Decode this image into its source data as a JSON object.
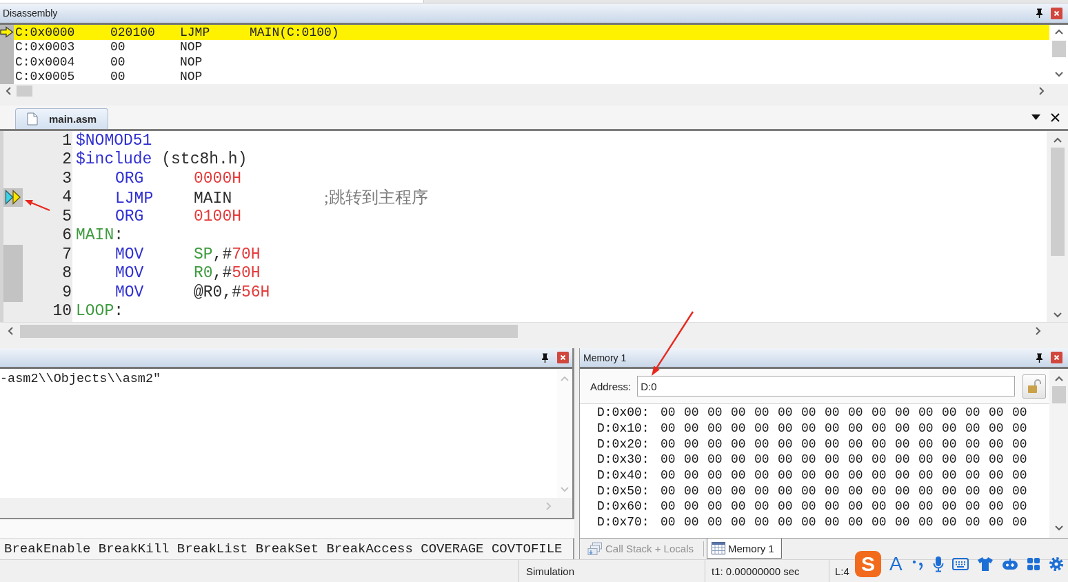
{
  "disassembly": {
    "title": "Disassembly",
    "rows": [
      {
        "address": "C:0x0000",
        "bytes": "020100",
        "mnemonic": "LJMP",
        "operand": "MAIN(C:0100)",
        "current": true
      },
      {
        "address": "C:0x0003",
        "bytes": "00",
        "mnemonic": "NOP",
        "current": false
      },
      {
        "address": "C:0x0004",
        "bytes": "00",
        "mnemonic": "NOP",
        "current": false
      },
      {
        "address": "C:0x0005",
        "bytes": "00",
        "mnemonic": "NOP",
        "current": false
      }
    ]
  },
  "editor": {
    "tabs": [
      {
        "label": "main.asm",
        "selected": true
      }
    ],
    "lines": [
      {
        "number": "1",
        "executable": false,
        "current": false,
        "head": [
          {
            "kind": "directive",
            "text": "$NOMOD51"
          }
        ]
      },
      {
        "number": "2",
        "executable": false,
        "current": false,
        "head": [
          {
            "kind": "directive",
            "text": "$include"
          },
          {
            "kind": "plain",
            "text": " (stc8h.h)"
          }
        ]
      },
      {
        "number": "3",
        "executable": false,
        "current": false,
        "mnemonic": "ORG",
        "operand": [
          {
            "kind": "number",
            "text": "0000H"
          }
        ]
      },
      {
        "number": "4",
        "executable": true,
        "current": true,
        "mnemonic": "LJMP",
        "operand": [
          {
            "kind": "plain",
            "text": "MAIN"
          }
        ],
        "comment": ";跳转到主程序"
      },
      {
        "number": "5",
        "executable": false,
        "current": false,
        "mnemonic": "ORG",
        "operand": [
          {
            "kind": "number",
            "text": "0100H"
          }
        ]
      },
      {
        "number": "6",
        "executable": false,
        "current": false,
        "head": [
          {
            "kind": "label",
            "text": "MAIN"
          },
          {
            "kind": "plain",
            "text": ":"
          }
        ]
      },
      {
        "number": "7",
        "executable": true,
        "current": false,
        "mnemonic": "MOV",
        "operand": [
          {
            "kind": "register",
            "text": "SP"
          },
          {
            "kind": "plain",
            "text": ",#"
          },
          {
            "kind": "number",
            "text": "70H"
          }
        ]
      },
      {
        "number": "8",
        "executable": true,
        "current": false,
        "mnemonic": "MOV",
        "operand": [
          {
            "kind": "register",
            "text": "R0"
          },
          {
            "kind": "plain",
            "text": ",#"
          },
          {
            "kind": "number",
            "text": "50H"
          }
        ]
      },
      {
        "number": "9",
        "executable": true,
        "current": false,
        "mnemonic": "MOV",
        "operand": [
          {
            "kind": "plain",
            "text": "@R0,#"
          },
          {
            "kind": "number",
            "text": "56H"
          }
        ]
      },
      {
        "number": "10",
        "executable": false,
        "current": false,
        "head": [
          {
            "kind": "label",
            "text": "LOOP"
          },
          {
            "kind": "plain",
            "text": ":"
          }
        ]
      }
    ]
  },
  "output": {
    "lines": [
      "-asm2\\\\Objects\\\\asm2\""
    ]
  },
  "command_hints": [
    "BreakEnable",
    "BreakKill",
    "BreakList",
    "BreakSet",
    "BreakAccess",
    "COVERAGE",
    "COVTOFILE"
  ],
  "memory": {
    "title": "Memory 1",
    "address_label": "Address:",
    "address_value": "D:0",
    "rows": [
      {
        "address": "D:0x00:",
        "values": [
          "00",
          "00",
          "00",
          "00",
          "00",
          "00",
          "00",
          "00",
          "00",
          "00",
          "00",
          "00",
          "00",
          "00",
          "00",
          "00"
        ]
      },
      {
        "address": "D:0x10:",
        "values": [
          "00",
          "00",
          "00",
          "00",
          "00",
          "00",
          "00",
          "00",
          "00",
          "00",
          "00",
          "00",
          "00",
          "00",
          "00",
          "00"
        ]
      },
      {
        "address": "D:0x20:",
        "values": [
          "00",
          "00",
          "00",
          "00",
          "00",
          "00",
          "00",
          "00",
          "00",
          "00",
          "00",
          "00",
          "00",
          "00",
          "00",
          "00"
        ]
      },
      {
        "address": "D:0x30:",
        "values": [
          "00",
          "00",
          "00",
          "00",
          "00",
          "00",
          "00",
          "00",
          "00",
          "00",
          "00",
          "00",
          "00",
          "00",
          "00",
          "00"
        ]
      },
      {
        "address": "D:0x40:",
        "values": [
          "00",
          "00",
          "00",
          "00",
          "00",
          "00",
          "00",
          "00",
          "00",
          "00",
          "00",
          "00",
          "00",
          "00",
          "00",
          "00"
        ]
      },
      {
        "address": "D:0x50:",
        "values": [
          "00",
          "00",
          "00",
          "00",
          "00",
          "00",
          "00",
          "00",
          "00",
          "00",
          "00",
          "00",
          "00",
          "00",
          "00",
          "00"
        ]
      },
      {
        "address": "D:0x60:",
        "values": [
          "00",
          "00",
          "00",
          "00",
          "00",
          "00",
          "00",
          "00",
          "00",
          "00",
          "00",
          "00",
          "00",
          "00",
          "00",
          "00"
        ]
      },
      {
        "address": "D:0x70:",
        "values": [
          "00",
          "00",
          "00",
          "00",
          "00",
          "00",
          "00",
          "00",
          "00",
          "00",
          "00",
          "00",
          "00",
          "00",
          "00",
          "00"
        ]
      }
    ],
    "tabs": [
      {
        "kind": "call_stack",
        "label": "Call Stack + Locals",
        "selected": false
      },
      {
        "kind": "memory",
        "label": "Memory 1",
        "selected": true
      }
    ]
  },
  "status_bar": {
    "mode": "Simulation",
    "time": "t1: 0.00000000 sec",
    "line": "L:4"
  },
  "ime_bar": {
    "logo": "S",
    "input_mode": "A"
  }
}
